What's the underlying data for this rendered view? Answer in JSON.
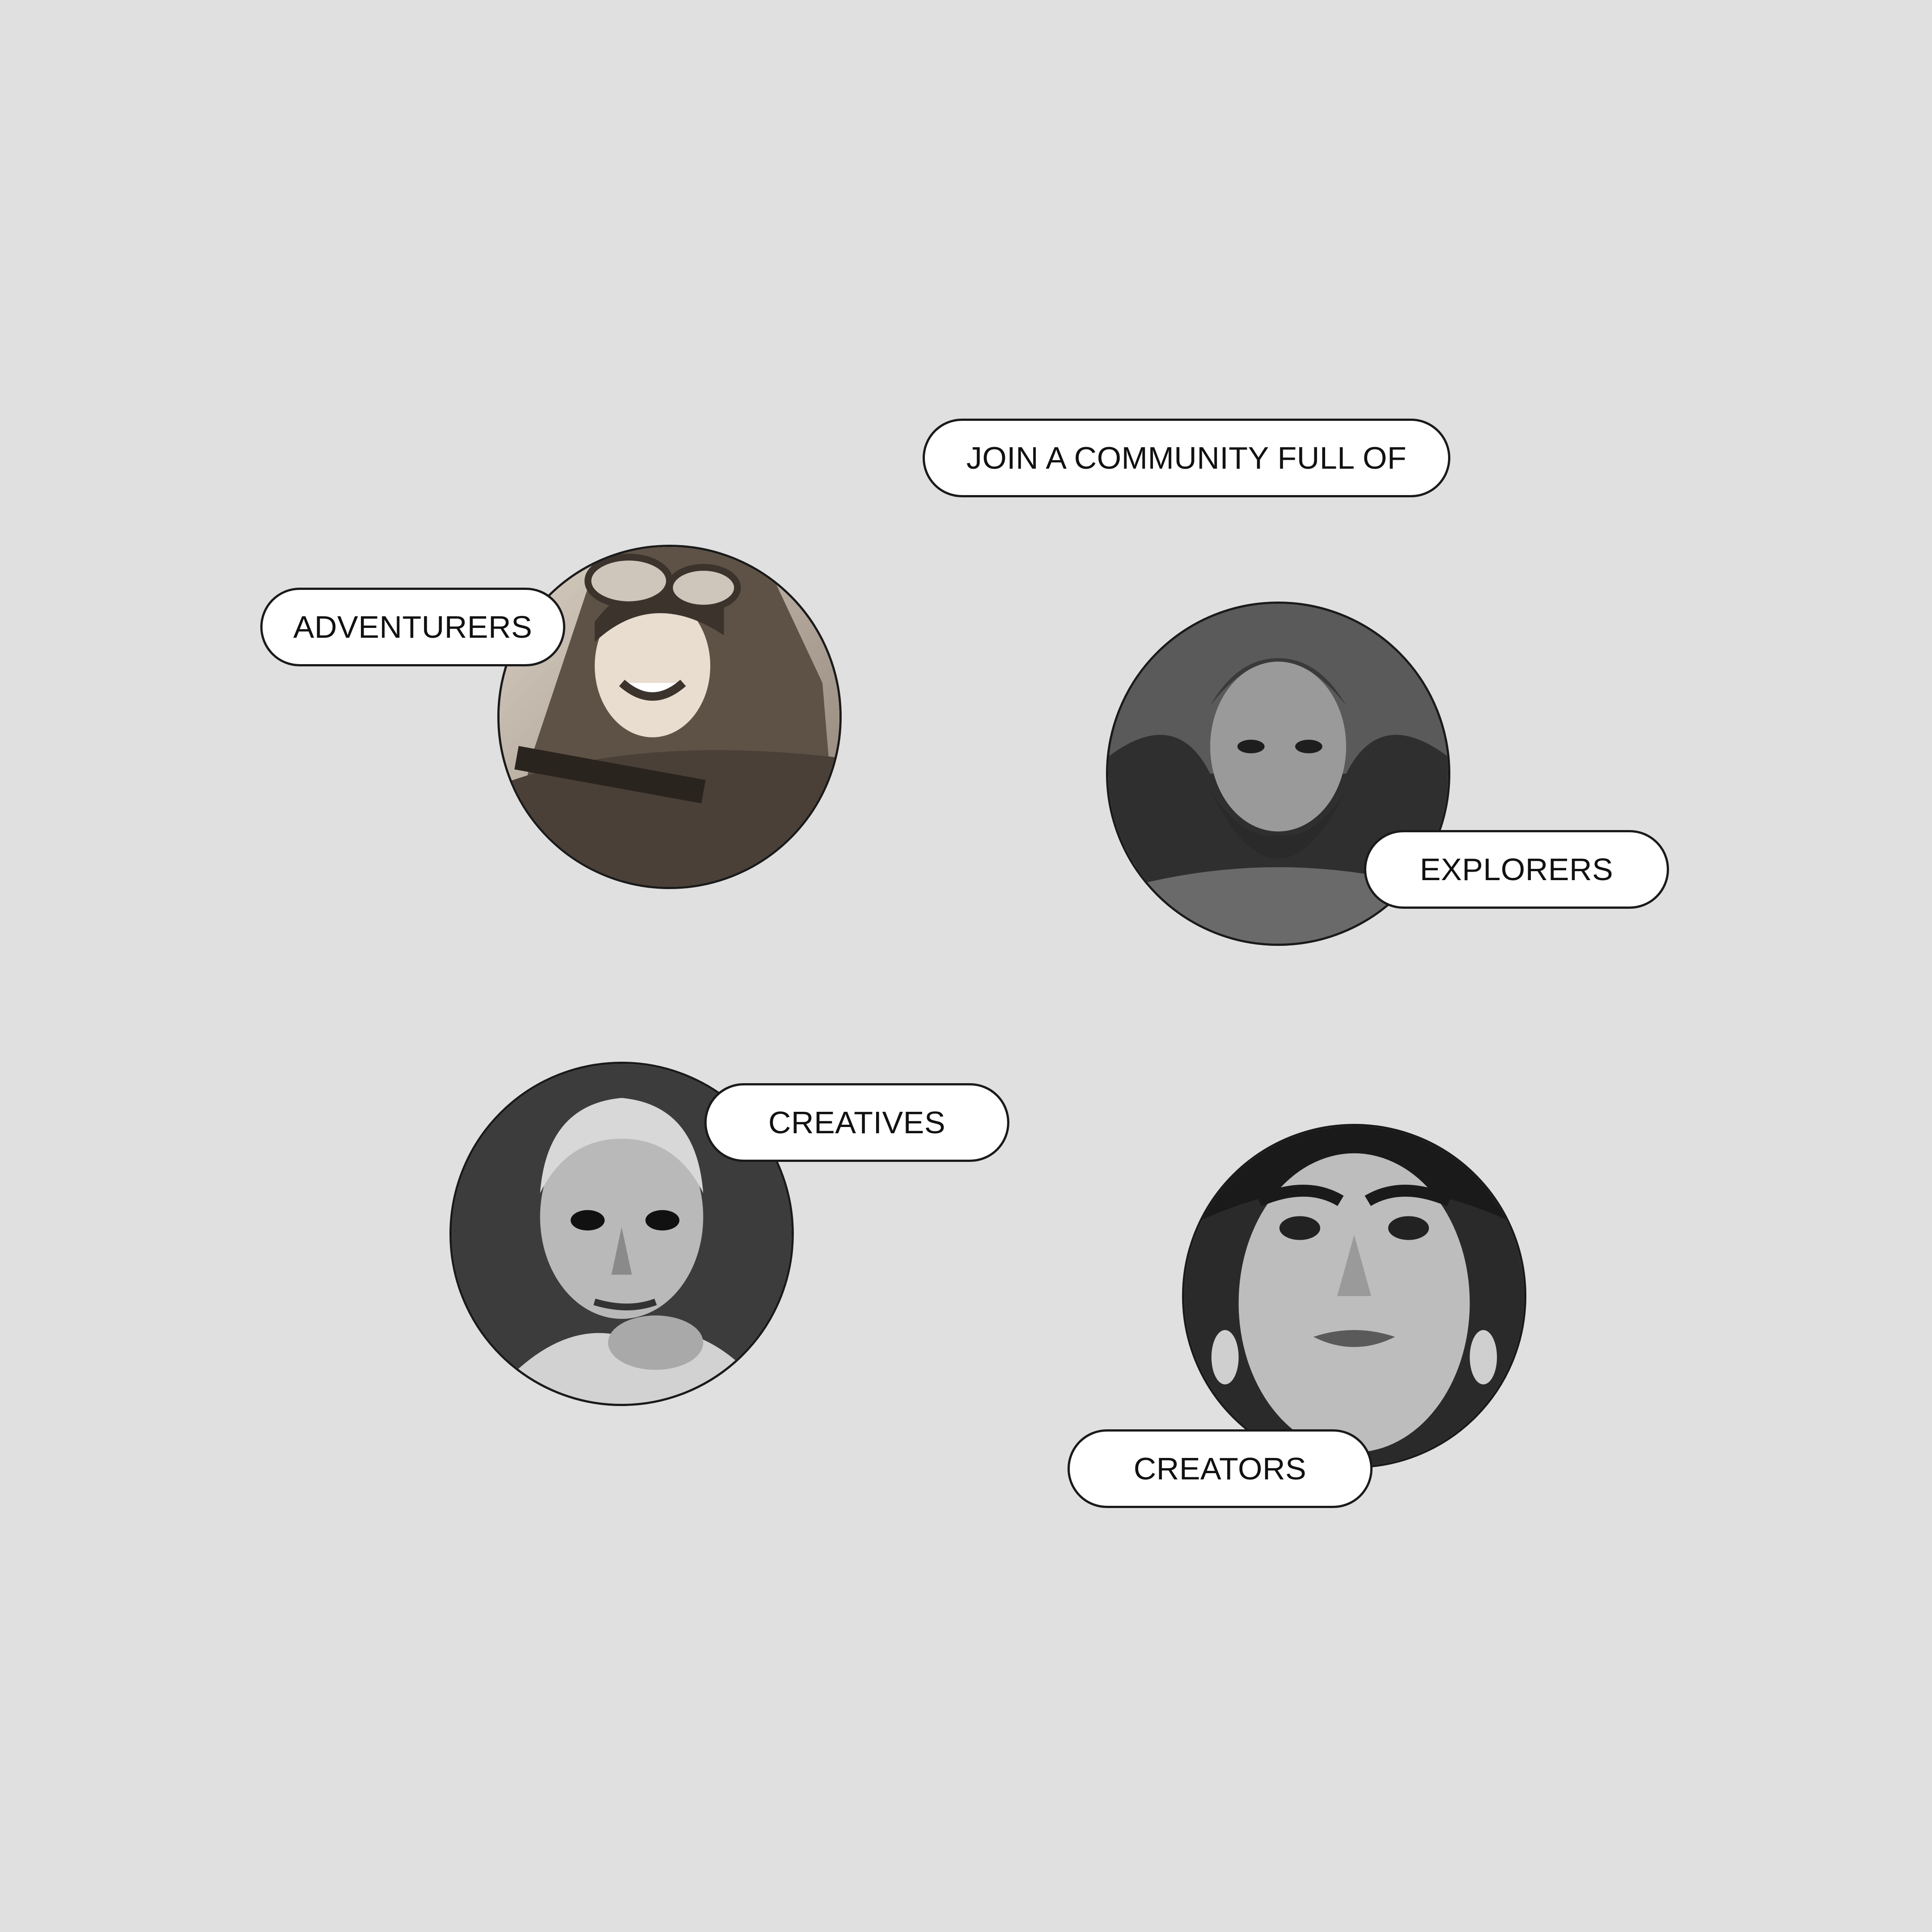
{
  "headline": {
    "label": "JOIN A COMMUNITY FULL OF"
  },
  "categories": [
    {
      "label": "ADVENTURERS",
      "portrait_icon": "aviator-portrait-icon"
    },
    {
      "label": "EXPLORERS",
      "portrait_icon": "bearded-man-portrait-icon"
    },
    {
      "label": "CREATIVES",
      "portrait_icon": "bald-man-portrait-icon"
    },
    {
      "label": "CREATORS",
      "portrait_icon": "woman-portrait-icon"
    }
  ],
  "colors": {
    "background": "#e0e0e0",
    "pill_background": "#ffffff",
    "outline": "#1a1a1a",
    "text": "#111111"
  }
}
